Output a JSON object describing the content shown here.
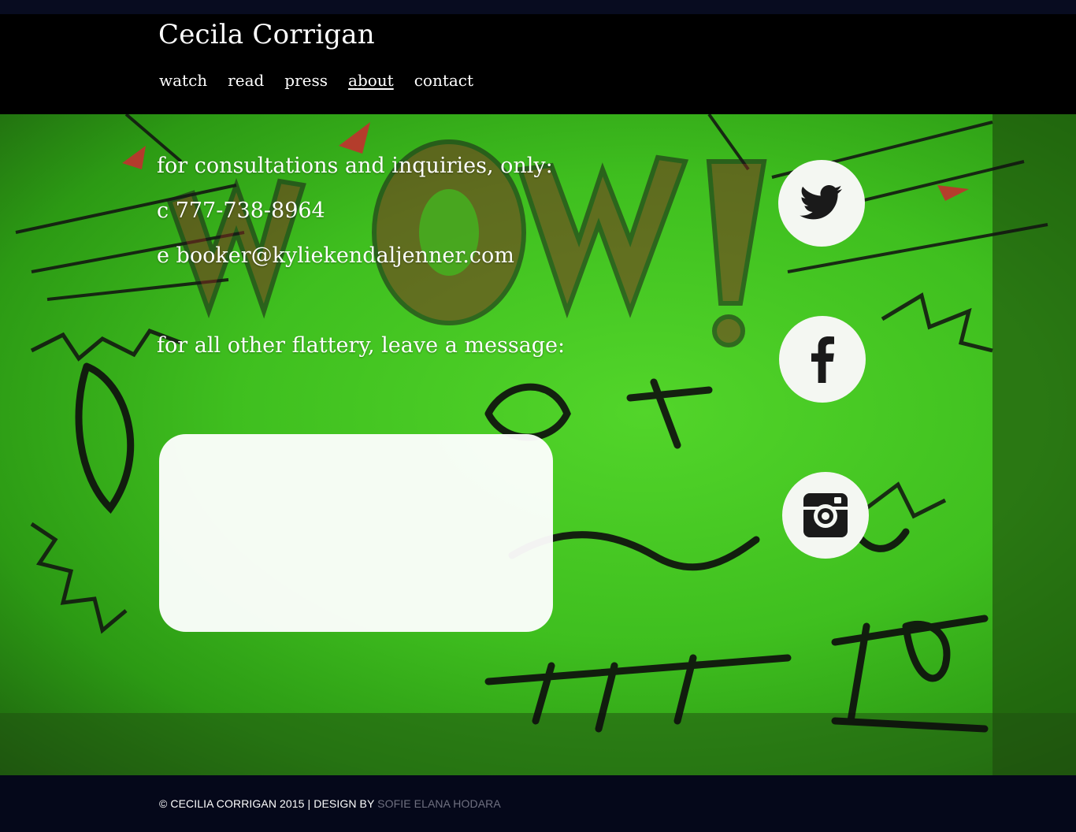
{
  "header": {
    "site_title": "Cecila Corrigan",
    "nav": [
      {
        "label": "watch",
        "active": false
      },
      {
        "label": "read",
        "active": false
      },
      {
        "label": "press",
        "active": false
      },
      {
        "label": "about",
        "active": true
      },
      {
        "label": "contact",
        "active": false
      }
    ]
  },
  "contact": {
    "consult_heading": "for consultations and inquiries, only:",
    "phone_line": "c 777-738-8964",
    "email_line": "e booker@kyliekendaljenner.com",
    "message_heading": "for all other flattery, leave a message:",
    "message_value": ""
  },
  "social": {
    "items": [
      {
        "icon": "twitter-icon"
      },
      {
        "icon": "facebook-icon"
      },
      {
        "icon": "instagram-icon"
      }
    ],
    "icon_color": "#1a1a1a",
    "circle_color": "#f4f7f2"
  },
  "footer": {
    "credit_text": "© CECILIA CORRIGAN 2015 | DESIGN BY ",
    "designer_link": "SOFIE ELANA HODARA"
  },
  "colors": {
    "header_bg": "#000000",
    "footer_bg": "#05081a",
    "sign_green": "#3fbf1f",
    "text": "#ffffff",
    "link_muted": "#6f7080"
  }
}
